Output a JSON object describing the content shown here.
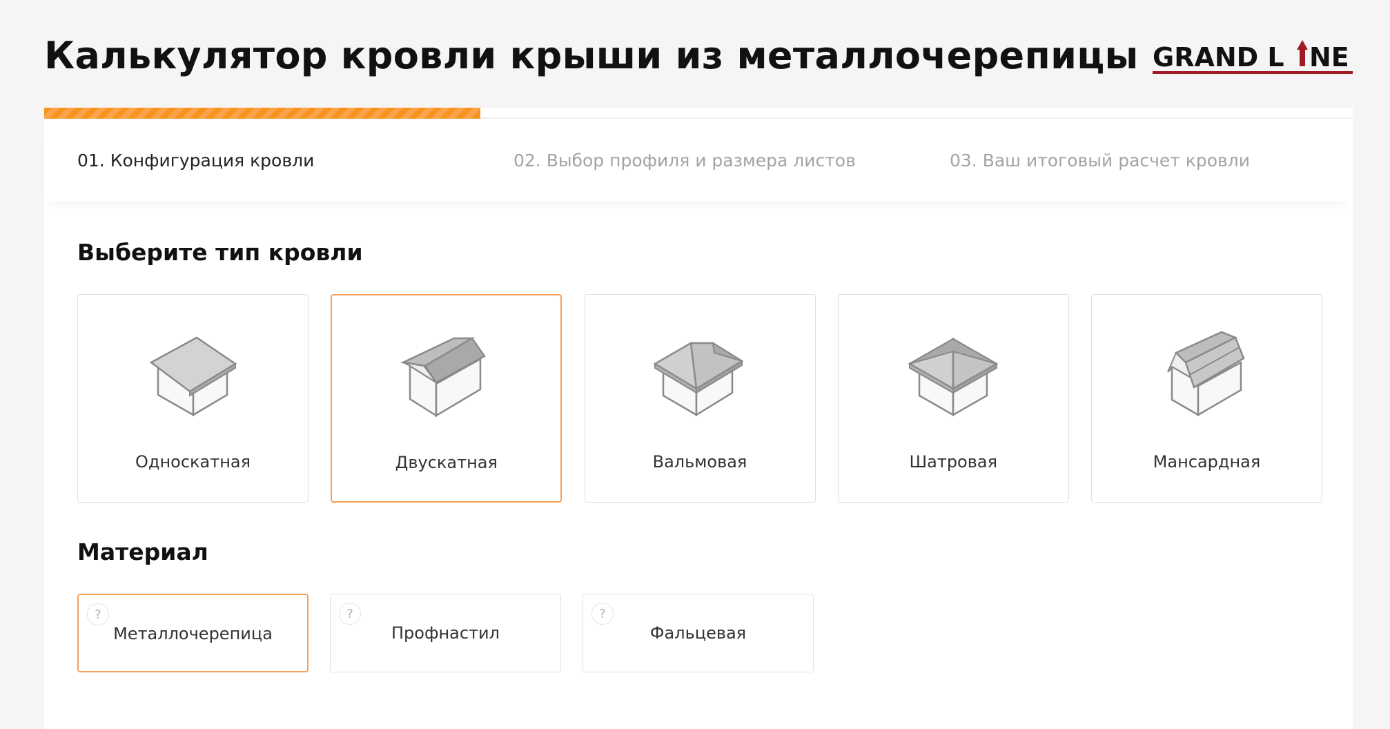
{
  "header": {
    "title": "Калькулятор кровли крыши из металлочерепицы",
    "logo_text": "GRAND LINE",
    "logo_color": "#a01c25"
  },
  "progress": {
    "current_step": 1,
    "total_steps": 3,
    "accent": "#f7941d"
  },
  "steps": [
    {
      "label": "01. Конфигурация кровли",
      "active": true
    },
    {
      "label": "02. Выбор профиля и размера листов",
      "active": false
    },
    {
      "label": "03. Ваш итоговый расчет кровли",
      "active": false
    }
  ],
  "roof_section": {
    "title": "Выберите тип кровли",
    "options": [
      {
        "label": "Односкатная",
        "icon": "single-pitch-roof-icon",
        "selected": false
      },
      {
        "label": "Двускатная",
        "icon": "gable-roof-icon",
        "selected": true
      },
      {
        "label": "Вальмовая",
        "icon": "hip-roof-icon",
        "selected": false
      },
      {
        "label": "Шатровая",
        "icon": "pyramid-roof-icon",
        "selected": false
      },
      {
        "label": "Мансардная",
        "icon": "mansard-roof-icon",
        "selected": false
      }
    ]
  },
  "material_section": {
    "title": "Материал",
    "options": [
      {
        "label": "Металлочерепица",
        "help": "?",
        "selected": true
      },
      {
        "label": "Профнастил",
        "help": "?",
        "selected": false
      },
      {
        "label": "Фальцевая",
        "help": "?",
        "selected": false
      }
    ]
  },
  "colors": {
    "selected_border": "#f7a05a",
    "roof_gray": "#c8c8c8",
    "outline": "#8a8a8a"
  }
}
